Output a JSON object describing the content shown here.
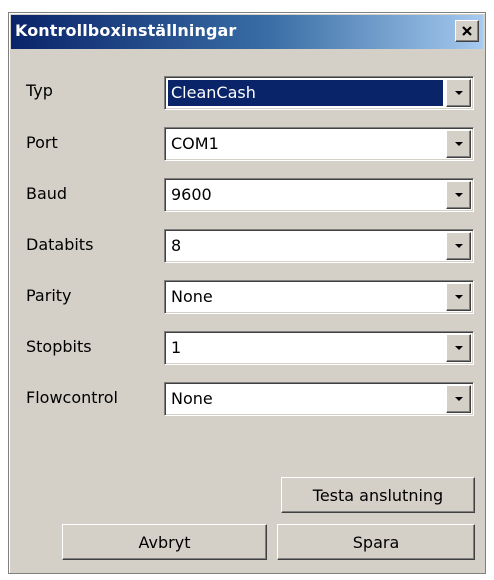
{
  "window": {
    "title": "Kontrollboxinställningar",
    "close_icon": "close-icon"
  },
  "fields": [
    {
      "label": "Typ",
      "value": "CleanCash",
      "selected": true
    },
    {
      "label": "Port",
      "value": "COM1"
    },
    {
      "label": "Baud",
      "value": "9600"
    },
    {
      "label": "Databits",
      "value": "8"
    },
    {
      "label": "Parity",
      "value": "None"
    },
    {
      "label": "Stopbits",
      "value": "1"
    },
    {
      "label": "Flowcontrol",
      "value": "None"
    }
  ],
  "buttons": {
    "test_connection": "Testa anslutning",
    "cancel": "Avbryt",
    "save": "Spara"
  },
  "colors": {
    "face": "#d4d0c8",
    "selection": "#0a246a",
    "titlebar_start": "#0a246a",
    "titlebar_end": "#a6caf0"
  }
}
